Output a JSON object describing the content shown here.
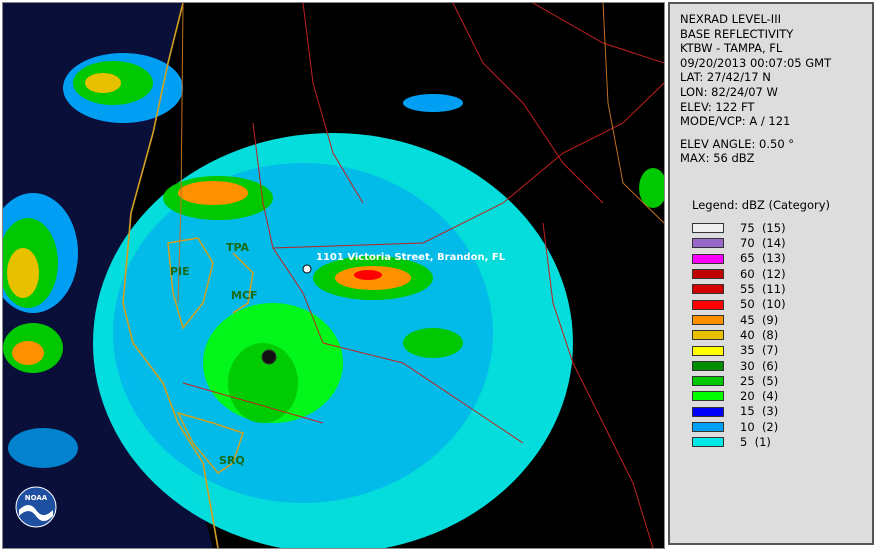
{
  "map": {
    "address_label": "1101 Victoria Street, Brandon, FL",
    "stations": [
      "TPA",
      "PIE",
      "MCF",
      "SRQ"
    ],
    "logo_text": "NOAA"
  },
  "info": {
    "lines": [
      "NEXRAD LEVEL-III",
      "BASE REFLECTIVITY",
      "KTBW - TAMPA, FL",
      "09/20/2013 00:07:05 GMT",
      "LAT: 27/42/17 N",
      "LON: 82/24/07 W",
      "ELEV: 122 FT",
      "MODE/VCP: A / 121"
    ],
    "elev_angle": "ELEV ANGLE: 0.50 °",
    "max": "MAX: 56 dBZ",
    "legend_title": "Legend: dBZ (Category)"
  },
  "legend": [
    {
      "label": "75  (15)",
      "color": "#eeeeee"
    },
    {
      "label": "70  (14)",
      "color": "#9966cc"
    },
    {
      "label": "65  (13)",
      "color": "#ff00ff"
    },
    {
      "label": "60  (12)",
      "color": "#c00000"
    },
    {
      "label": "55  (11)",
      "color": "#d40000"
    },
    {
      "label": "50  (10)",
      "color": "#ff0000"
    },
    {
      "label": "45  (9)",
      "color": "#ff9000"
    },
    {
      "label": "40  (8)",
      "color": "#e7c000"
    },
    {
      "label": "35  (7)",
      "color": "#ffff00"
    },
    {
      "label": "30  (6)",
      "color": "#008e00"
    },
    {
      "label": "25  (5)",
      "color": "#01c801"
    },
    {
      "label": "20  (4)",
      "color": "#02fd02"
    },
    {
      "label": "15  (3)",
      "color": "#0000f6"
    },
    {
      "label": "10  (2)",
      "color": "#019ff4"
    },
    {
      "label": "5  (1)",
      "color": "#04e9e7"
    }
  ]
}
